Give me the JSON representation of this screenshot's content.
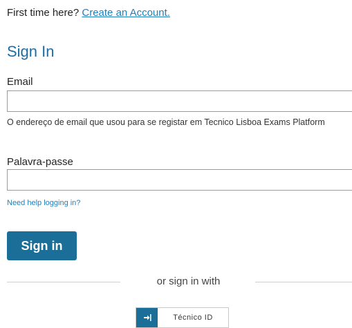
{
  "intro": {
    "prefix": "First time here?",
    "create_account_link": "Create an Account."
  },
  "form": {
    "title": "Sign In",
    "email_label": "Email",
    "email_value": "",
    "email_hint": "O endereço de email que usou para se registar em Tecnico Lisboa Exams Platform",
    "password_label": "Palavra-passe",
    "password_value": "",
    "help_link": "Need help logging in?",
    "submit_label": "Sign in"
  },
  "alt_signin": {
    "divider_text": "or sign in with",
    "provider_label": "Técnico ID",
    "provider_icon": "sign-in-icon"
  },
  "colors": {
    "accent": "#1a6e98",
    "link": "#1e7fb8",
    "title": "#1b6ea8"
  }
}
